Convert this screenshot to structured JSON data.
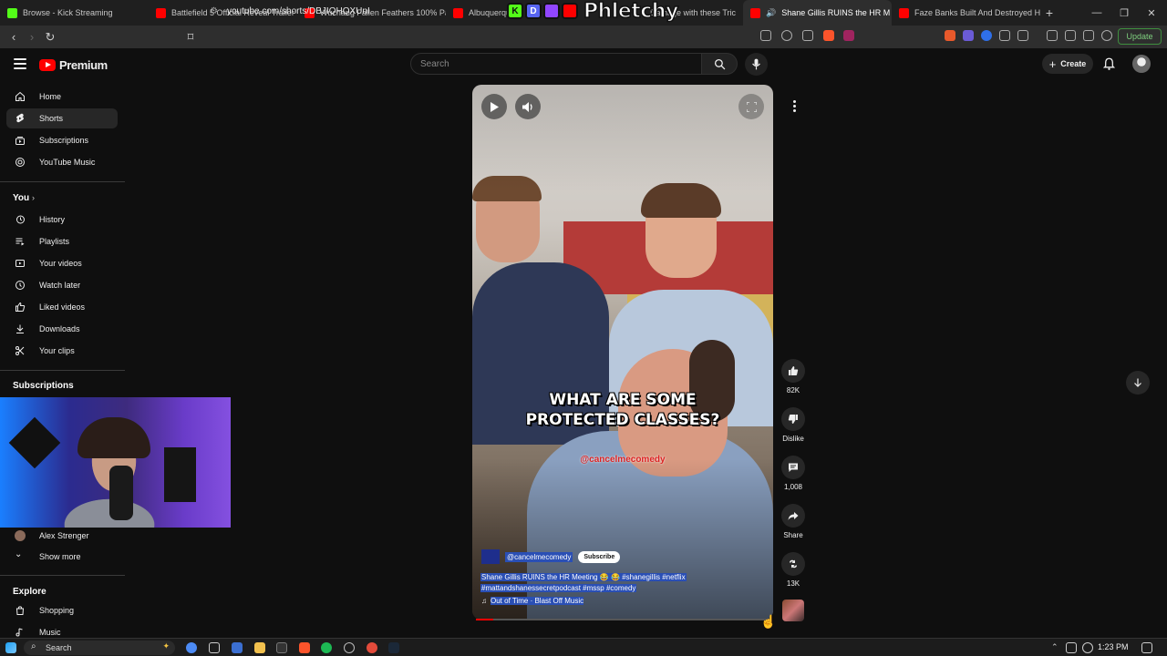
{
  "browser": {
    "tabs": [
      {
        "title": "Browse - Kick Streaming",
        "favicon_color": "#53fc18"
      },
      {
        "title": "Battlefield 5 Official Reveal Trailer - Y",
        "favicon_color": "#ff0000"
      },
      {
        "title": "Wuchang Fallen Feathers 100% Part",
        "favicon_color": "#ff0000"
      },
      {
        "title": "Albuquerque",
        "favicon_color": "#ff0000"
      },
      {
        "title": "Damage with these Tric",
        "favicon_color": "#ff0000"
      },
      {
        "title": "Shane Gillis RUINS the HR M",
        "favicon_color": "#ff0000",
        "active": true
      },
      {
        "title": "Faze Banks Built And Destroyed His",
        "favicon_color": "#ff0000"
      }
    ],
    "new_tab_label": "+",
    "url": "youtube.com/shorts/DBJIQHQXUnI",
    "update_label": "Update"
  },
  "overlay": {
    "brand": "Phletchy",
    "badges": [
      "K",
      "D",
      "",
      ""
    ]
  },
  "header": {
    "logo_text": "Premium",
    "search_placeholder": "Search",
    "create_label": "Create"
  },
  "sidebar": {
    "main": [
      {
        "label": "Home",
        "icon": "home-icon"
      },
      {
        "label": "Shorts",
        "icon": "shorts-icon",
        "active": true
      },
      {
        "label": "Subscriptions",
        "icon": "subscriptions-icon"
      },
      {
        "label": "YouTube Music",
        "icon": "music-icon"
      }
    ],
    "you_heading": "You",
    "you": [
      {
        "label": "History",
        "icon": "history-icon"
      },
      {
        "label": "Playlists",
        "icon": "playlists-icon"
      },
      {
        "label": "Your videos",
        "icon": "your-videos-icon"
      },
      {
        "label": "Watch later",
        "icon": "watch-later-icon"
      },
      {
        "label": "Liked videos",
        "icon": "thumbs-up-icon"
      },
      {
        "label": "Downloads",
        "icon": "download-icon"
      },
      {
        "label": "Your clips",
        "icon": "scissors-icon"
      }
    ],
    "subscriptions_heading": "Subscriptions",
    "subscriptions": [
      {
        "label": "Alex Strenger"
      }
    ],
    "show_more": "Show more",
    "explore_heading": "Explore",
    "explore": [
      {
        "label": "Shopping",
        "icon": "shopping-icon"
      },
      {
        "label": "Music",
        "icon": "music-note-icon"
      }
    ]
  },
  "short": {
    "caption_line1": "WHAT ARE SOME",
    "caption_line2": "PROTECTED CLASSES?",
    "watermark": "@cancelmecomedy",
    "channel": "@cancelmecomedy",
    "subscribe_label": "Subscribe",
    "description_line1": "Shane Gillis RUINS the HR Meeting 😂 😂 #shanegillis #netflix",
    "description_line2": "#mattandshanessecretpodcast #mssp #comedy",
    "music": "Out of Time · Blast Off Music",
    "progress": 0.06
  },
  "actions": {
    "likes": "82K",
    "dislike_label": "Dislike",
    "comments": "1,008",
    "share_label": "Share",
    "remix_count": "13K"
  },
  "taskbar": {
    "search_placeholder": "Search",
    "time": "1:23 PM"
  }
}
